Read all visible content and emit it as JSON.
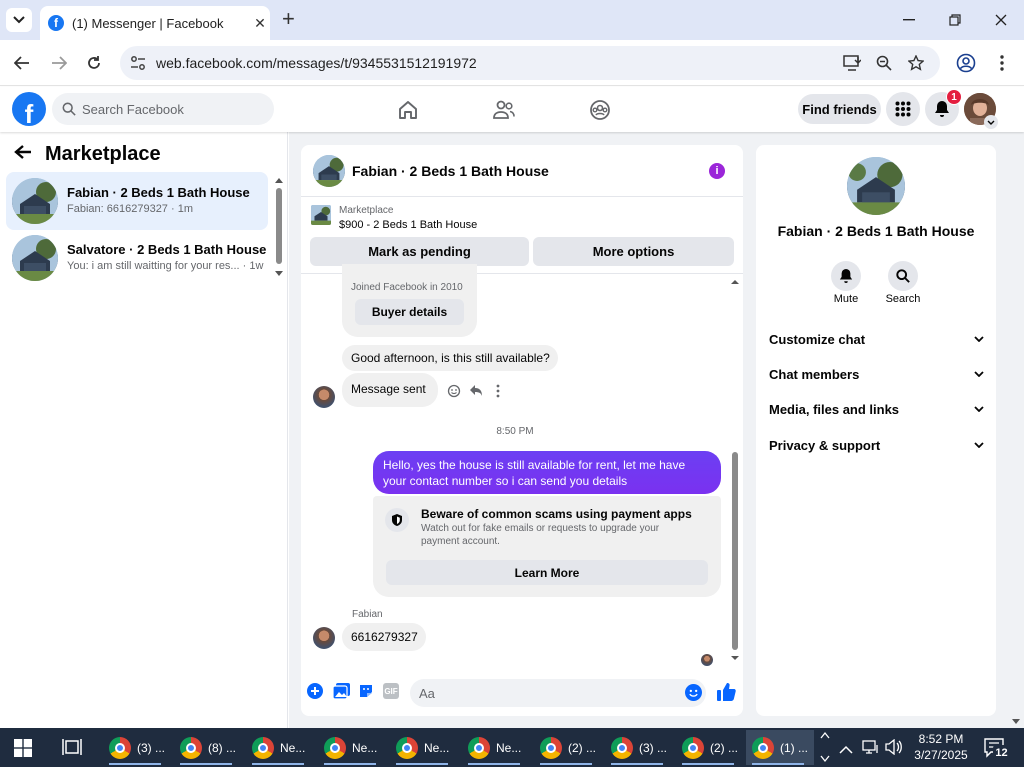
{
  "browser": {
    "tab_title": "(1) Messenger | Facebook",
    "url": "web.facebook.com/messages/t/9345531512191972"
  },
  "fb": {
    "search_placeholder": "Search Facebook",
    "find_friends": "Find friends",
    "notif_count": "1"
  },
  "left": {
    "title": "Marketplace",
    "conversations": [
      {
        "name": "Fabian · 2 Beds 1 Bath House",
        "sub": "Fabian: 6616279327 · 1m"
      },
      {
        "name": "Salvatore · 2 Beds 1 Bath House",
        "sub": "You: i am still waitting for your res... · 1w"
      }
    ]
  },
  "chat": {
    "title": "Fabian · 2 Beds 1 Bath House",
    "mp_label": "Marketplace",
    "mp_item": "$900 - 2 Beds 1 Bath House",
    "mark_pending": "Mark as pending",
    "more_options": "More options",
    "joined": "Joined Facebook in 2010",
    "buyer_details": "Buyer details",
    "msg1": "Good afternoon, is this still available?",
    "msg2": "Message sent",
    "time": "8:50 PM",
    "reply": "Hello, yes the house is still available for rent, let me have your contact number so i can send you  details",
    "scam_title": "Beware of common scams using payment apps",
    "scam_body": "Watch out for fake emails or requests to upgrade your payment account.",
    "learn_more": "Learn More",
    "sender": "Fabian",
    "msg3": "6616279327",
    "composer_placeholder": "Aa"
  },
  "right": {
    "name": "Fabian · 2 Beds 1 Bath House",
    "mute": "Mute",
    "search": "Search",
    "rows": [
      "Customize chat",
      "Chat members",
      "Media, files and links",
      "Privacy & support"
    ]
  },
  "taskbar": {
    "items": [
      "(3) ...",
      "(8) ...",
      "Ne...",
      "Ne...",
      "Ne...",
      "Ne...",
      "(2) ...",
      "(3) ...",
      "(2) ...",
      "(1) ..."
    ],
    "time": "8:52 PM",
    "date": "3/27/2025",
    "notif": "12"
  }
}
